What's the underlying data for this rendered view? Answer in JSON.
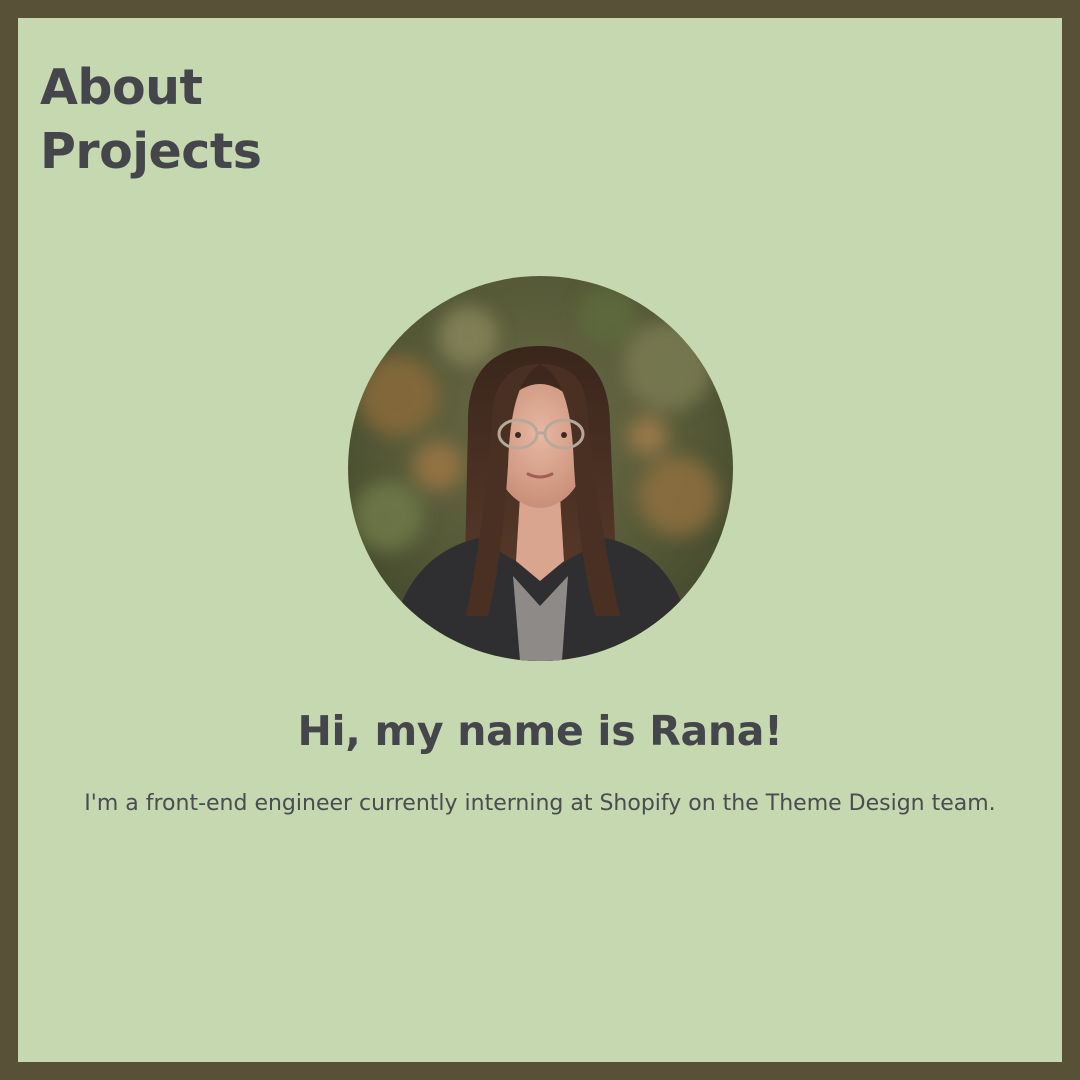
{
  "nav": {
    "items": [
      {
        "label": "About"
      },
      {
        "label": "Projects"
      }
    ]
  },
  "profile": {
    "photo_icon": "profile-photo",
    "greeting": "Hi, my name is Rana!",
    "intro": "I'm a front-end engineer currently interning at Shopify on the Theme Design team."
  },
  "colors": {
    "frame_border": "#585137",
    "background": "#c5d8b0",
    "text": "#45464b"
  }
}
